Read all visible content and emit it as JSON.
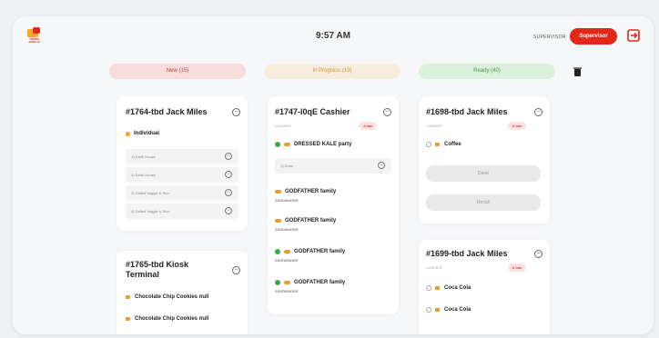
{
  "header": {
    "logo_text": "ORDER DISPLAY",
    "time": "9:57 AM",
    "user_label": "SUPERVISOR",
    "supervisor_button": "Supervisor",
    "exit_icon": "exit-icon"
  },
  "tabs": [
    {
      "label": "New (15)",
      "color": "#f9dcdc"
    },
    {
      "label": "In Progress (19)",
      "color": "#f8eddc"
    },
    {
      "label": "Ready (40)",
      "color": "#dcf1dc"
    }
  ],
  "column_new": {
    "card1": {
      "title": "#1764-tbd Jack Miles",
      "order_type": "Individual",
      "items": [
        "1) Earth House",
        "2) Earth House",
        "3) Grilled Veggie & Rice",
        "4) Grilled Veggie & Rice"
      ]
    },
    "card2": {
      "title": "#1765-tbd Kiosk Terminal",
      "items": [
        "Chocolate Chip Cookies null",
        "Chocolate Chip Cookies null"
      ]
    }
  },
  "column_progress": {
    "card1": {
      "title": "#1747-l0qE Cashier",
      "sub": "CASHIER",
      "badge": "4 min",
      "item1": "DRESSED KALE party",
      "item1_field": "1) Done",
      "item2": "GODFATHER family",
      "item2_sub": "SIDEWINDER",
      "item3": "GODFATHER family",
      "item3_sub": "SIDEWINDER",
      "item4": "GODFATHER family",
      "item4_sub": "SIDEWINDER",
      "item5": "GODFATHER family",
      "item5_sub": "SIDEWINDER"
    }
  },
  "column_ready": {
    "card1": {
      "title": "#1698-tbd Jack Miles",
      "sub": "CASHIER",
      "badge": "6 min",
      "item": "Coffee",
      "btn_done": "Done",
      "btn_recall": "Recall"
    },
    "card2": {
      "title": "#1699-tbd Jack Miles",
      "sub": "CASHIER",
      "badge": "6 min",
      "item1": "Coca Cola",
      "item2": "Coca Cola"
    }
  }
}
